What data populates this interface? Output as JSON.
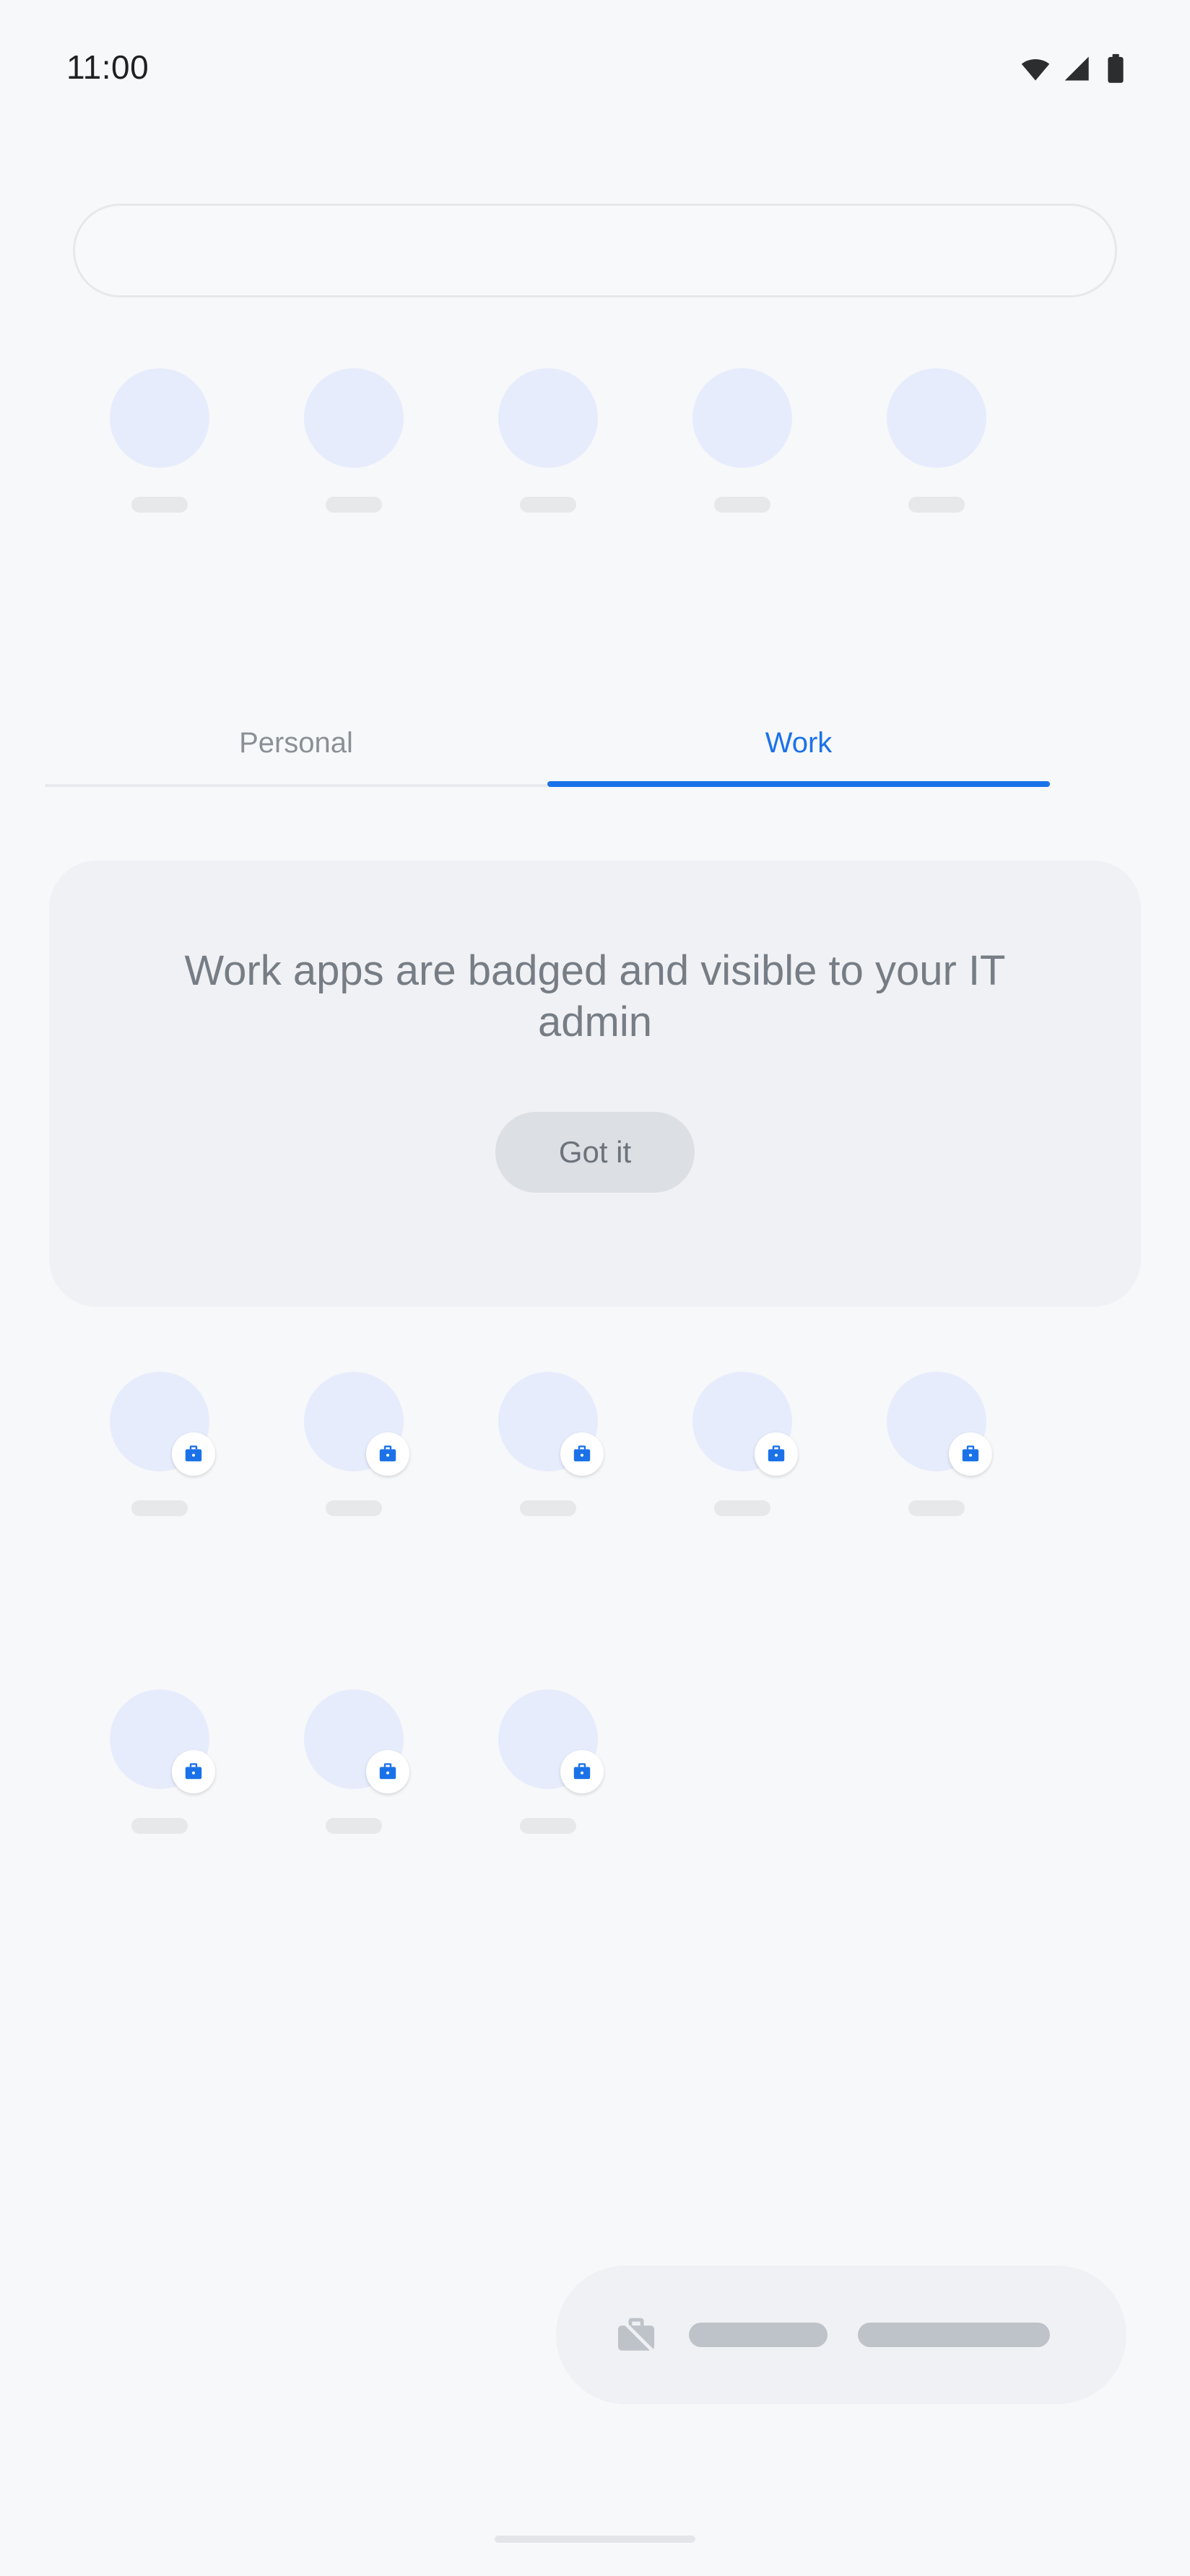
{
  "status_bar": {
    "time": "11:00",
    "icons": [
      {
        "name": "wifi-icon",
        "label": "wifi"
      },
      {
        "name": "cell-signal-icon",
        "label": "signal"
      },
      {
        "name": "battery-icon",
        "label": "battery"
      }
    ]
  },
  "search": {
    "value": "",
    "placeholder": ""
  },
  "predicted_apps": {
    "count": 5,
    "items": [
      {
        "label": "",
        "badged": false
      },
      {
        "label": "",
        "badged": false
      },
      {
        "label": "",
        "badged": false
      },
      {
        "label": "",
        "badged": false
      },
      {
        "label": "",
        "badged": false
      }
    ]
  },
  "tabs": {
    "personal_label": "Personal",
    "work_label": "Work",
    "selected": "Work",
    "active_color": "#1b72e8",
    "inactive_color": "#8b9096"
  },
  "info_card": {
    "message": "Work apps are badged and visible to your IT admin",
    "button_label": "Got it",
    "background": "#f0f1f4",
    "text_color": "#767d85"
  },
  "work_apps": {
    "row1": [
      {
        "label": "",
        "badged": true
      },
      {
        "label": "",
        "badged": true
      },
      {
        "label": "",
        "badged": true
      },
      {
        "label": "",
        "badged": true
      },
      {
        "label": "",
        "badged": true
      }
    ],
    "row2": [
      {
        "label": "",
        "badged": true
      },
      {
        "label": "",
        "badged": true
      },
      {
        "label": "",
        "badged": true
      }
    ],
    "badge_icon": "work-briefcase-icon",
    "badge_color": "#1b72e8"
  },
  "work_toggle_bar": {
    "icon": "work-profile-off-icon",
    "pill_1": "",
    "pill_2": "",
    "background": "#f0f1f4"
  },
  "navigation": {
    "gesture_handle": ""
  },
  "colors": {
    "page_background": "#f7f8fa",
    "app_icon_placeholder": "#e6ecfb",
    "label_placeholder": "#e7e8ea",
    "accent_blue": "#1b72e8"
  }
}
